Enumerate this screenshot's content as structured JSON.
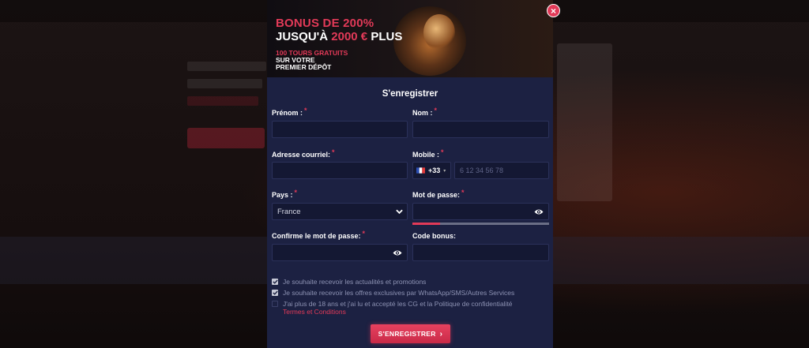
{
  "banner": {
    "line1": "BONUS DE 200%",
    "line2_prefix": "JUSQU'À",
    "line2_amount": "2000 €",
    "line2_suffix": "PLUS",
    "line3": "100 TOURS GRATUITS",
    "line4": "SUR VOTRE PREMIER DÉPÔT"
  },
  "close": {
    "icon": "close-icon",
    "label": "×"
  },
  "form": {
    "title": "S'enregistrer",
    "required_mark": "*",
    "fields": {
      "prenom": {
        "label": "Prénom :",
        "value": ""
      },
      "nom": {
        "label": "Nom :",
        "value": ""
      },
      "email": {
        "label": "Adresse courriel:",
        "value": ""
      },
      "mobile": {
        "label": "Mobile :",
        "flag": "france-flag-icon",
        "code": "+33",
        "placeholder": "6 12 34 56 78"
      },
      "pays": {
        "label": "Pays :",
        "value": "France"
      },
      "password": {
        "label": "Mot de passe:",
        "value": ""
      },
      "confirm": {
        "label": "Confirme le mot de passe:",
        "value": ""
      },
      "bonus": {
        "label": "Code bonus:",
        "value": ""
      }
    },
    "password_strength": 0.2,
    "checkboxes": [
      {
        "label": "Je souhaite recevoir les actualités et promotions",
        "checked": true
      },
      {
        "label": "Je souhaite recevoir les offres exclusives par WhatsApp/SMS/Autres Services",
        "checked": true
      },
      {
        "label": "J'ai plus de 18 ans et j'ai lu et accepté les CG et la Politique de confidentialité",
        "link": "Termes et Conditions",
        "checked": false
      }
    ],
    "submit_label": "S'ENREGISTRER",
    "submit_arrow": "›"
  },
  "colors": {
    "accent": "#e23a58",
    "modal_bg": "#1c2142",
    "field_bg": "#141833"
  }
}
